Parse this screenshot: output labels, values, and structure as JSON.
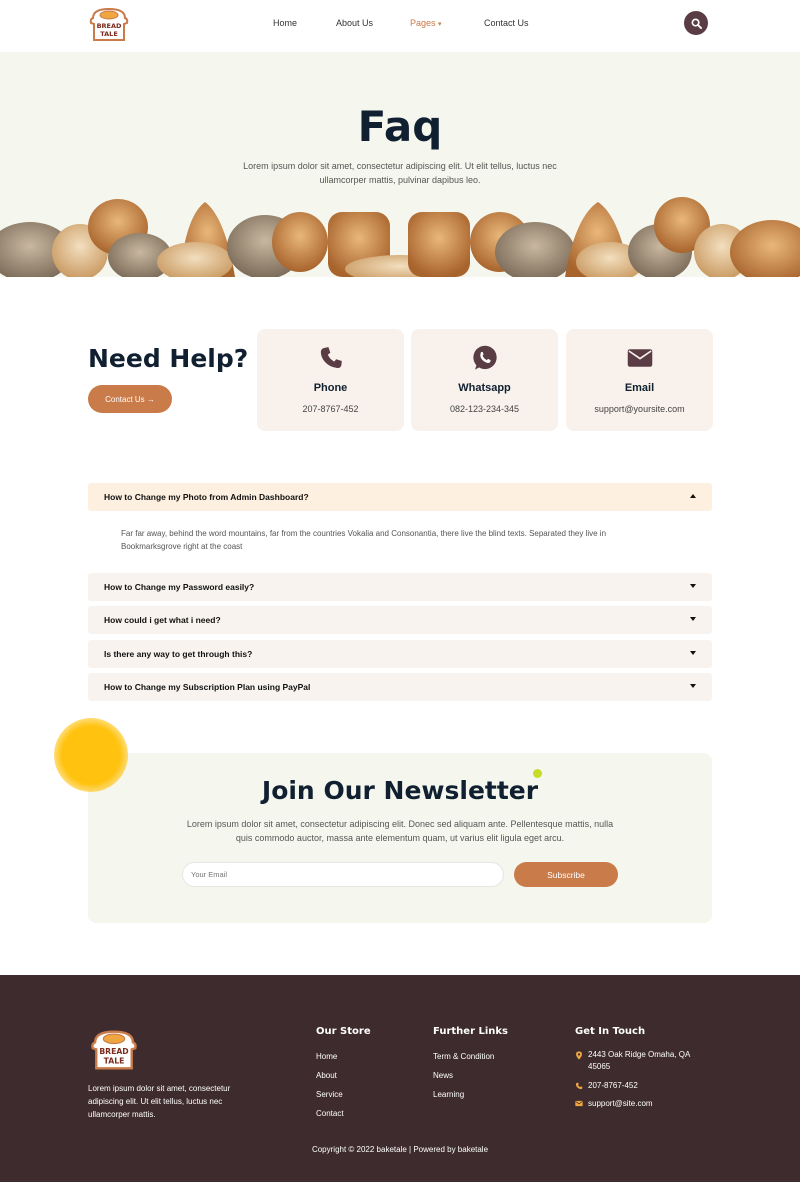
{
  "header": {
    "logo_text": [
      "BREAD",
      "TALE"
    ],
    "nav": [
      {
        "label": "Home"
      },
      {
        "label": "About Us"
      },
      {
        "label": "Pages",
        "active": true
      },
      {
        "label": "Contact Us"
      }
    ],
    "search_icon": "search-icon"
  },
  "hero": {
    "title": "Faq",
    "subtitle": "Lorem ipsum dolor sit amet, consectetur adipiscing elit. Ut elit tellus, luctus nec ullamcorper mattis, pulvinar dapibus leo."
  },
  "help": {
    "title": "Need Help?",
    "button": "Contact Us →",
    "cards": [
      {
        "icon": "phone-icon",
        "title": "Phone",
        "value": "207-8767-452"
      },
      {
        "icon": "whatsapp-icon",
        "title": "Whatsapp",
        "value": "082-123-234-345"
      },
      {
        "icon": "envelope-icon",
        "title": "Email",
        "value": "support@yoursite.com"
      }
    ]
  },
  "faq": {
    "items": [
      {
        "question": "How to Change my Photo from Admin Dashboard?",
        "open": true
      },
      {
        "question": "How to Change my Password easily?",
        "open": false
      },
      {
        "question": "How could i get what i need?",
        "open": false
      },
      {
        "question": "Is there any way to get through this?",
        "open": false
      },
      {
        "question": "How to Change my Subscription Plan using PayPal",
        "open": false
      }
    ],
    "answer": "Far far away, behind the word mountains, far from the countries Vokalia and Consonantia, there live the blind texts. Separated they live in Bookmarksgrove right at the coast"
  },
  "newsletter": {
    "title": "Join Our Newsletter",
    "subtitle": "Lorem ipsum dolor sit amet, consectetur adipiscing elit. Donec sed aliquam ante. Pellentesque mattis, nulla quis commodo auctor, massa ante elementum quam, ut varius elit ligula eget arcu.",
    "placeholder": "Your Email",
    "button": "Subscribe"
  },
  "footer": {
    "description": "Lorem ipsum dolor sit amet, consectetur adipiscing elit. Ut elit tellus, luctus nec ullamcorper mattis.",
    "store": {
      "heading": "Our Store",
      "links": [
        "Home",
        "About",
        "Service",
        "Contact"
      ]
    },
    "further": {
      "heading": "Further Links",
      "links": [
        "Term & Condition",
        "News",
        "Learning"
      ]
    },
    "contact": {
      "heading": "Get In Touch",
      "address": "2443 Oak Ridge Omaha, QA 45065",
      "phone": "207-8767-452",
      "email": "support@site.com"
    },
    "copyright": "Copyright © 2022 baketale | Powered by baketale"
  },
  "colors": {
    "accent": "#c97b4a",
    "dark": "#102030",
    "footer_bg": "#3d2b2e",
    "icon": "#5a3d44",
    "hero_bg": "#f5f7ee"
  }
}
